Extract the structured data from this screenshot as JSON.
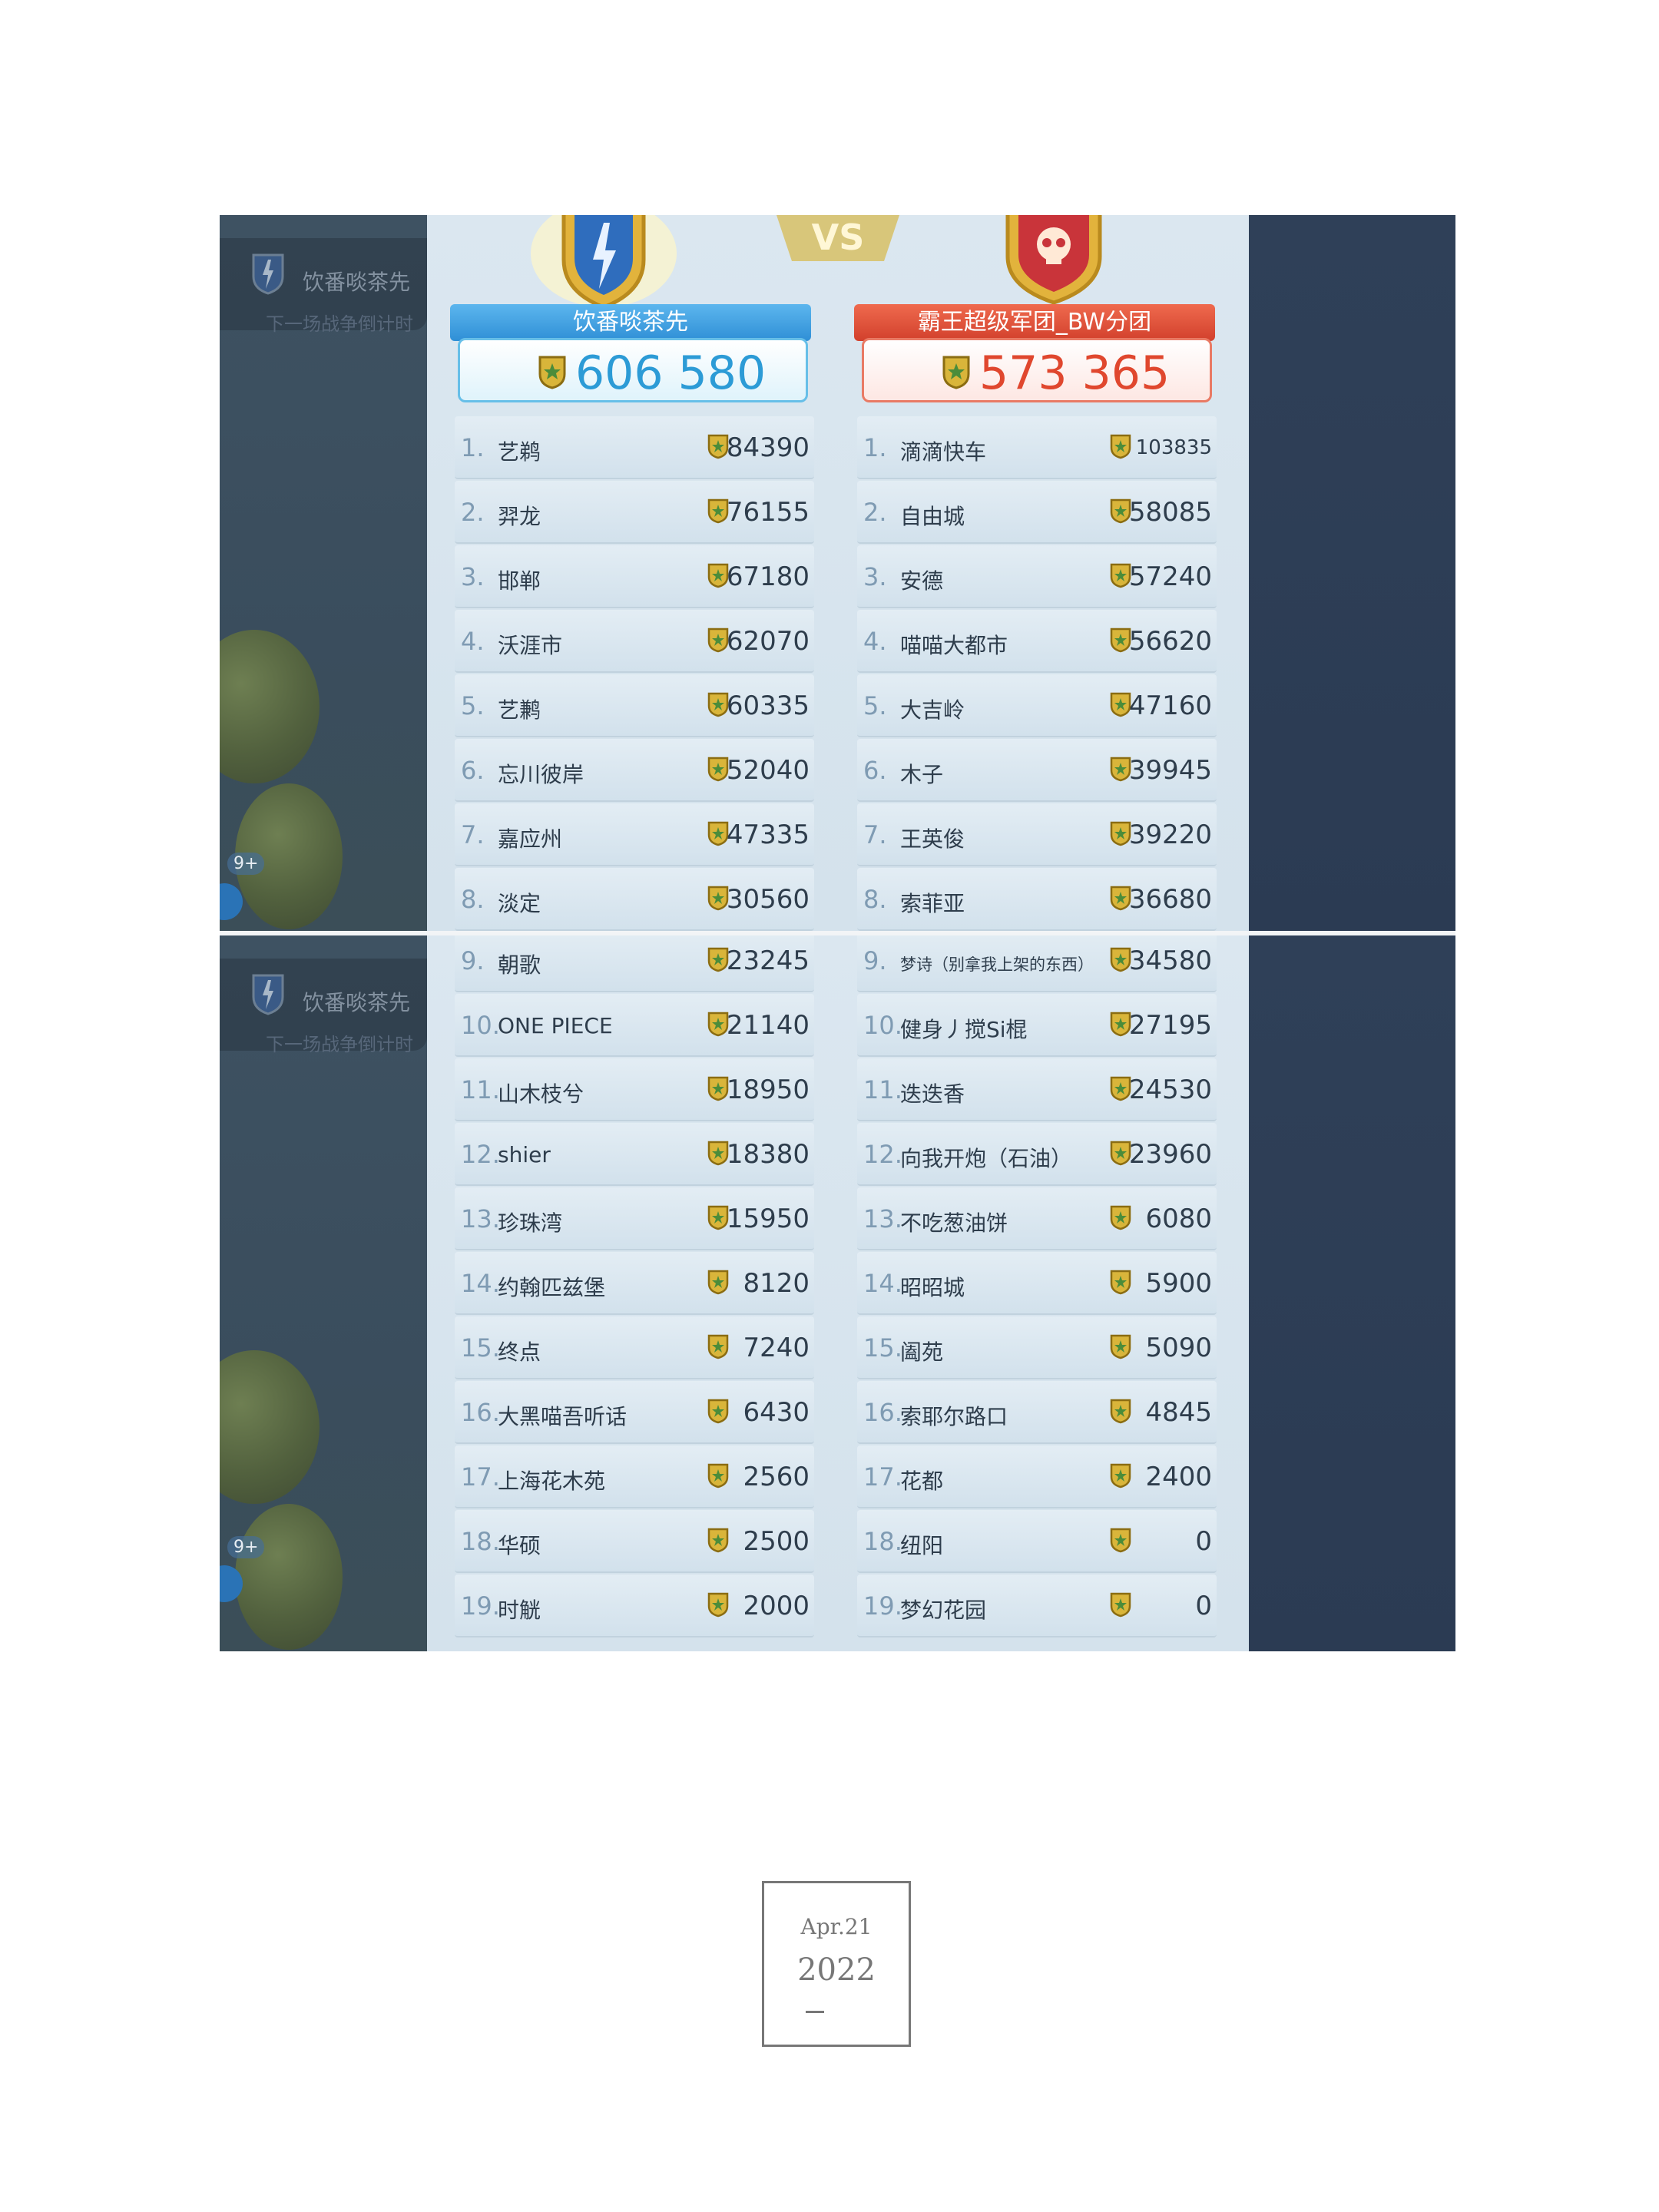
{
  "header": {
    "left_team": {
      "name": "饮番啖茶先",
      "total": "606 580",
      "color": "#2f8fd6"
    },
    "right_team": {
      "name": "霸王超级军团_BW分团",
      "total": "573 365",
      "color": "#d2402c"
    },
    "vs_label": "VS"
  },
  "background": {
    "faint_alliance_name": "饮番啖茶先",
    "faint_subtitle": "下一场战争倒计时",
    "badge_count": "9+"
  },
  "left_list": [
    {
      "rank": "1.",
      "name": "艺鹈",
      "score": "84390"
    },
    {
      "rank": "2.",
      "name": "羿龙",
      "score": "76155"
    },
    {
      "rank": "3.",
      "name": "邯郸",
      "score": "67180"
    },
    {
      "rank": "4.",
      "name": "沃涯市",
      "score": "62070"
    },
    {
      "rank": "5.",
      "name": "艺鹣",
      "score": "60335"
    },
    {
      "rank": "6.",
      "name": "忘川彼岸",
      "score": "52040"
    },
    {
      "rank": "7.",
      "name": "嘉应州",
      "score": "47335"
    },
    {
      "rank": "8.",
      "name": "淡定",
      "score": "30560"
    },
    {
      "rank": "9.",
      "name": "朝歌",
      "score": "23245"
    },
    {
      "rank": "10.",
      "name": "ONE PIECE",
      "score": "21140"
    },
    {
      "rank": "11.",
      "name": "山木枝兮",
      "score": "18950"
    },
    {
      "rank": "12.",
      "name": "shier",
      "score": "18380"
    },
    {
      "rank": "13.",
      "name": "珍珠湾",
      "score": "15950"
    },
    {
      "rank": "14.",
      "name": "约翰匹兹堡",
      "score": "8120"
    },
    {
      "rank": "15.",
      "name": "终点",
      "score": "7240"
    },
    {
      "rank": "16.",
      "name": "大黑喵吾听话",
      "score": "6430"
    },
    {
      "rank": "17.",
      "name": "上海花木苑",
      "score": "2560"
    },
    {
      "rank": "18.",
      "name": "华硕",
      "score": "2500"
    },
    {
      "rank": "19.",
      "name": "时觥",
      "score": "2000"
    }
  ],
  "right_list": [
    {
      "rank": "1.",
      "name": "滴滴快车",
      "score": "103835"
    },
    {
      "rank": "2.",
      "name": "自由城",
      "score": "58085"
    },
    {
      "rank": "3.",
      "name": "安德",
      "score": "57240"
    },
    {
      "rank": "4.",
      "name": "喵喵大都市",
      "score": "56620"
    },
    {
      "rank": "5.",
      "name": "大吉岭",
      "score": "47160"
    },
    {
      "rank": "6.",
      "name": "木子",
      "score": "39945"
    },
    {
      "rank": "7.",
      "name": "王英俊",
      "score": "39220"
    },
    {
      "rank": "8.",
      "name": "索菲亚",
      "score": "36680"
    },
    {
      "rank": "9.",
      "name": "梦诗（别拿我上架的东西）",
      "score": "34580"
    },
    {
      "rank": "10.",
      "name": "健身丿搅Si棍",
      "score": "27195"
    },
    {
      "rank": "11.",
      "name": "迭迭香",
      "score": "24530"
    },
    {
      "rank": "12.",
      "name": "向我开炮（石油）",
      "score": "23960"
    },
    {
      "rank": "13.",
      "name": "不吃葱油饼",
      "score": "6080"
    },
    {
      "rank": "14.",
      "name": "昭昭城",
      "score": "5900"
    },
    {
      "rank": "15.",
      "name": "阖苑",
      "score": "5090"
    },
    {
      "rank": "16.",
      "name": "索耶尔路口",
      "score": "4845"
    },
    {
      "rank": "17.",
      "name": "花都",
      "score": "2400"
    },
    {
      "rank": "18.",
      "name": "纽阳",
      "score": "0"
    },
    {
      "rank": "19.",
      "name": "梦幻花园",
      "score": "0"
    }
  ],
  "date_card": {
    "month": "Apr.21",
    "year": "2022"
  },
  "icons": {
    "shield": "shield-coin-icon",
    "left_emblem": "lightning-shield-icon",
    "right_emblem": "skull-shield-icon"
  }
}
